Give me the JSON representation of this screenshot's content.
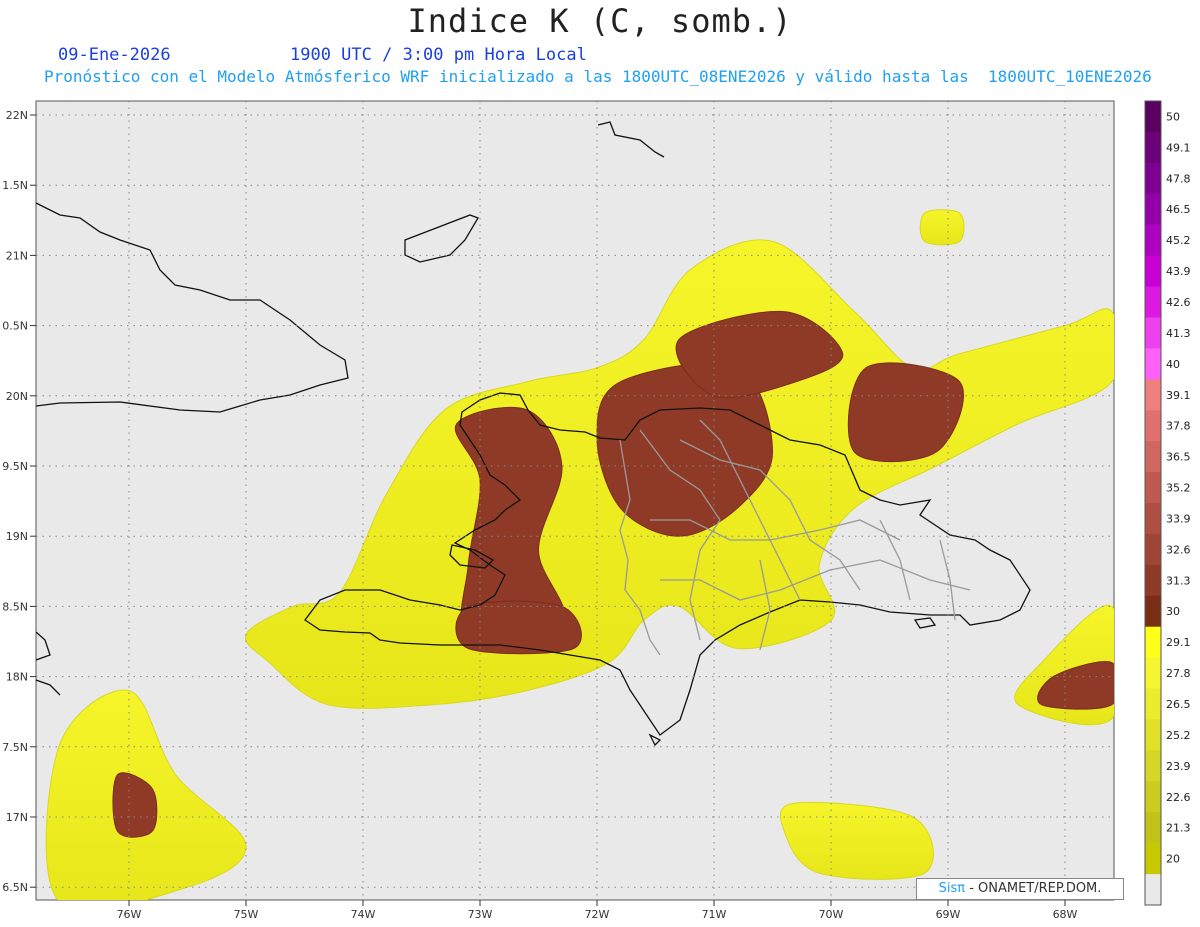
{
  "header": {
    "title": "Indice K (C, somb.)",
    "date": "09-Ene-2026",
    "time": "1900 UTC / 3:00 pm Hora Local",
    "forecast": "Pronóstico con el Modelo Atmósferico WRF inicializado a las 1800UTC_08ENE2026 y válido hasta las  1800UTC_10ENE2026"
  },
  "credit": {
    "brand": "Sisπ",
    "org": " - ONAMET/REP.DOM."
  },
  "map": {
    "lon_range": [
      -76.6,
      -67.6
    ],
    "lat_range": [
      16.4,
      22.1
    ],
    "lat_ticks": [
      {
        "value": 22.0,
        "label": "22N"
      },
      {
        "value": 21.5,
        "label": "1.5N"
      },
      {
        "value": 21.0,
        "label": "21N"
      },
      {
        "value": 20.5,
        "label": "0.5N"
      },
      {
        "value": 20.0,
        "label": "20N"
      },
      {
        "value": 19.5,
        "label": "9.5N"
      },
      {
        "value": 19.0,
        "label": "19N"
      },
      {
        "value": 18.5,
        "label": "8.5N"
      },
      {
        "value": 18.0,
        "label": "18N"
      },
      {
        "value": 17.5,
        "label": "7.5N"
      },
      {
        "value": 17.0,
        "label": "17N"
      },
      {
        "value": 16.5,
        "label": "6.5N"
      }
    ],
    "lon_ticks": [
      {
        "value": -76,
        "label": "76W"
      },
      {
        "value": -75,
        "label": "75W"
      },
      {
        "value": -74,
        "label": "74W"
      },
      {
        "value": -73,
        "label": "73W"
      },
      {
        "value": -72,
        "label": "72W"
      },
      {
        "value": -71,
        "label": "71W"
      },
      {
        "value": -70,
        "label": "70W"
      },
      {
        "value": -69,
        "label": "69W"
      },
      {
        "value": -68,
        "label": "68W"
      }
    ],
    "background_color": "#e9e9e9",
    "yellow_color": "#f2f21a",
    "brown_color": "#8e3a26",
    "light_brown_color": "#b0584a",
    "yellow_regions": [
      {
        "name": "main",
        "pts": [
          [
            -74.2,
            18.6
          ],
          [
            -73.8,
            19.3
          ],
          [
            -73.3,
            19.9
          ],
          [
            -72.6,
            20.1
          ],
          [
            -72.0,
            20.2
          ],
          [
            -71.6,
            20.4
          ],
          [
            -71.2,
            20.9
          ],
          [
            -70.5,
            21.1
          ],
          [
            -69.8,
            20.6
          ],
          [
            -69.3,
            20.2
          ],
          [
            -68.9,
            20.3
          ],
          [
            -68.0,
            20.5
          ],
          [
            -67.6,
            20.6
          ],
          [
            -67.6,
            20.1
          ],
          [
            -68.4,
            19.8
          ],
          [
            -69.1,
            19.5
          ],
          [
            -69.8,
            19.2
          ],
          [
            -70.1,
            18.8
          ],
          [
            -70.0,
            18.4
          ],
          [
            -70.8,
            18.2
          ],
          [
            -71.3,
            18.5
          ],
          [
            -71.6,
            18.4
          ],
          [
            -71.9,
            18.1
          ],
          [
            -72.6,
            17.9
          ],
          [
            -73.4,
            17.8
          ],
          [
            -74.3,
            17.8
          ],
          [
            -74.8,
            18.1
          ],
          [
            -75.0,
            18.3
          ],
          [
            -74.6,
            18.5
          ]
        ]
      },
      {
        "name": "southwest",
        "pts": [
          [
            -76.6,
            17.5
          ],
          [
            -76.0,
            17.9
          ],
          [
            -75.6,
            17.3
          ],
          [
            -75.0,
            16.8
          ],
          [
            -75.5,
            16.5
          ],
          [
            -76.6,
            16.4
          ]
        ]
      },
      {
        "name": "east",
        "pts": [
          [
            -68.2,
            18.1
          ],
          [
            -67.6,
            18.5
          ],
          [
            -67.6,
            17.7
          ],
          [
            -68.4,
            17.8
          ]
        ]
      },
      {
        "name": "south-islands",
        "pts": [
          [
            -70.3,
            17.1
          ],
          [
            -69.3,
            17.0
          ],
          [
            -69.2,
            16.6
          ],
          [
            -70.1,
            16.6
          ],
          [
            -70.4,
            16.9
          ]
        ]
      },
      {
        "name": "ne-islet",
        "pts": [
          [
            -69.2,
            21.3
          ],
          [
            -68.9,
            21.3
          ],
          [
            -68.9,
            21.1
          ],
          [
            -69.2,
            21.1
          ]
        ]
      }
    ],
    "brown_regions": [
      {
        "name": "haiti-north",
        "pts": [
          [
            -73.2,
            19.8
          ],
          [
            -72.6,
            19.9
          ],
          [
            -72.3,
            19.5
          ],
          [
            -72.5,
            18.9
          ],
          [
            -72.3,
            18.4
          ],
          [
            -73.1,
            18.3
          ],
          [
            -73.1,
            18.8
          ],
          [
            -73.0,
            19.4
          ]
        ]
      },
      {
        "name": "haiti-south",
        "pts": [
          [
            -73.1,
            18.5
          ],
          [
            -72.3,
            18.5
          ],
          [
            -72.2,
            18.2
          ],
          [
            -73.1,
            18.2
          ]
        ]
      },
      {
        "name": "cibao",
        "pts": [
          [
            -71.8,
            20.1
          ],
          [
            -70.8,
            20.2
          ],
          [
            -70.5,
            19.6
          ],
          [
            -70.8,
            19.2
          ],
          [
            -71.3,
            19.0
          ],
          [
            -71.8,
            19.2
          ],
          [
            -72.0,
            19.7
          ]
        ]
      },
      {
        "name": "north-sea",
        "pts": [
          [
            -71.3,
            20.4
          ],
          [
            -70.4,
            20.6
          ],
          [
            -69.9,
            20.3
          ],
          [
            -70.3,
            20.1
          ],
          [
            -71.0,
            20.0
          ]
        ]
      },
      {
        "name": "ne-sea",
        "pts": [
          [
            -69.7,
            20.2
          ],
          [
            -68.9,
            20.1
          ],
          [
            -69.1,
            19.6
          ],
          [
            -69.8,
            19.6
          ]
        ]
      },
      {
        "name": "southwest-blob",
        "pts": [
          [
            -76.1,
            17.3
          ],
          [
            -75.8,
            17.2
          ],
          [
            -75.8,
            16.9
          ],
          [
            -76.1,
            16.9
          ]
        ]
      },
      {
        "name": "east-blob",
        "pts": [
          [
            -68.1,
            18.0
          ],
          [
            -67.6,
            18.1
          ],
          [
            -67.6,
            17.8
          ],
          [
            -68.2,
            17.8
          ]
        ]
      }
    ]
  }
}
